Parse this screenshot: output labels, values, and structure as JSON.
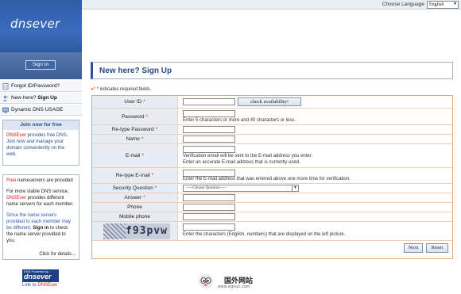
{
  "topbar": {
    "choose_language_label": "Choose Language",
    "language_value": "English"
  },
  "sidebar": {
    "logo": "dnsever",
    "signin_label": "Sign In",
    "links": [
      {
        "label": "Forgot ID/Password?"
      },
      {
        "label_plain": "New here?",
        "label_bold": "Sign Up"
      },
      {
        "label": "Dynamic DNS USAGE"
      }
    ],
    "join": {
      "title": "Join now for free",
      "brand": "DNSEver",
      "line1": " provides free DNS.",
      "line2": "Join now and manage your domain conveniently on the web."
    },
    "free": {
      "free_word": "Free",
      "free_rest": " nameservers are provided",
      "p2_a": "For more stable DNS service, ",
      "p2_brand": "DNSEver",
      "p2_b": " provides different name servers for each member.",
      "p3_blue": "Since the name servers provided to each member may be different, ",
      "p3_bold": "Sign in",
      "p3_c": " to check the name server provided to you.",
      "click_details": "Click for details..."
    },
    "badge": {
      "top_text": "DNS Powered by...",
      "brand": "dnsever",
      "link_text_a": "Link to ",
      "link_text_b": "DNSEver"
    }
  },
  "main": {
    "title": "New here? Sign Up",
    "required_note": " * indicates required fields.",
    "form": {
      "userid_label": "User ID",
      "check_availability": "check availability!",
      "password_label": "Password",
      "password_hint": "Enter 5 characters or more and 40 characters or less.",
      "retype_password_label": "Re-type Password",
      "name_label": "Name",
      "email_label": "E-mail",
      "email_hint1": "Verification email will be sent to the E-mail address you enter.",
      "email_hint2": "Enter an accurate E-mail address that is currently used.",
      "retype_email_label": "Re-type E-mail",
      "retype_email_hint": "Enter the E-mail address that was entered above one more time for verification.",
      "security_question_label": "Security Question",
      "security_question_value": "-----Choose Question-----",
      "answer_label": "Answer",
      "phone_label": "Phone",
      "mobile_label": "Mobile phone",
      "captcha_text": "f93pvw",
      "captcha_hint": "Enter the characters (English, numbers) that are displayed on the left picture.",
      "next_label": "Next",
      "reset_label": "Reset"
    }
  },
  "footer": {
    "cn_text": "国外网站",
    "url_text": "www.egouz.com"
  }
}
